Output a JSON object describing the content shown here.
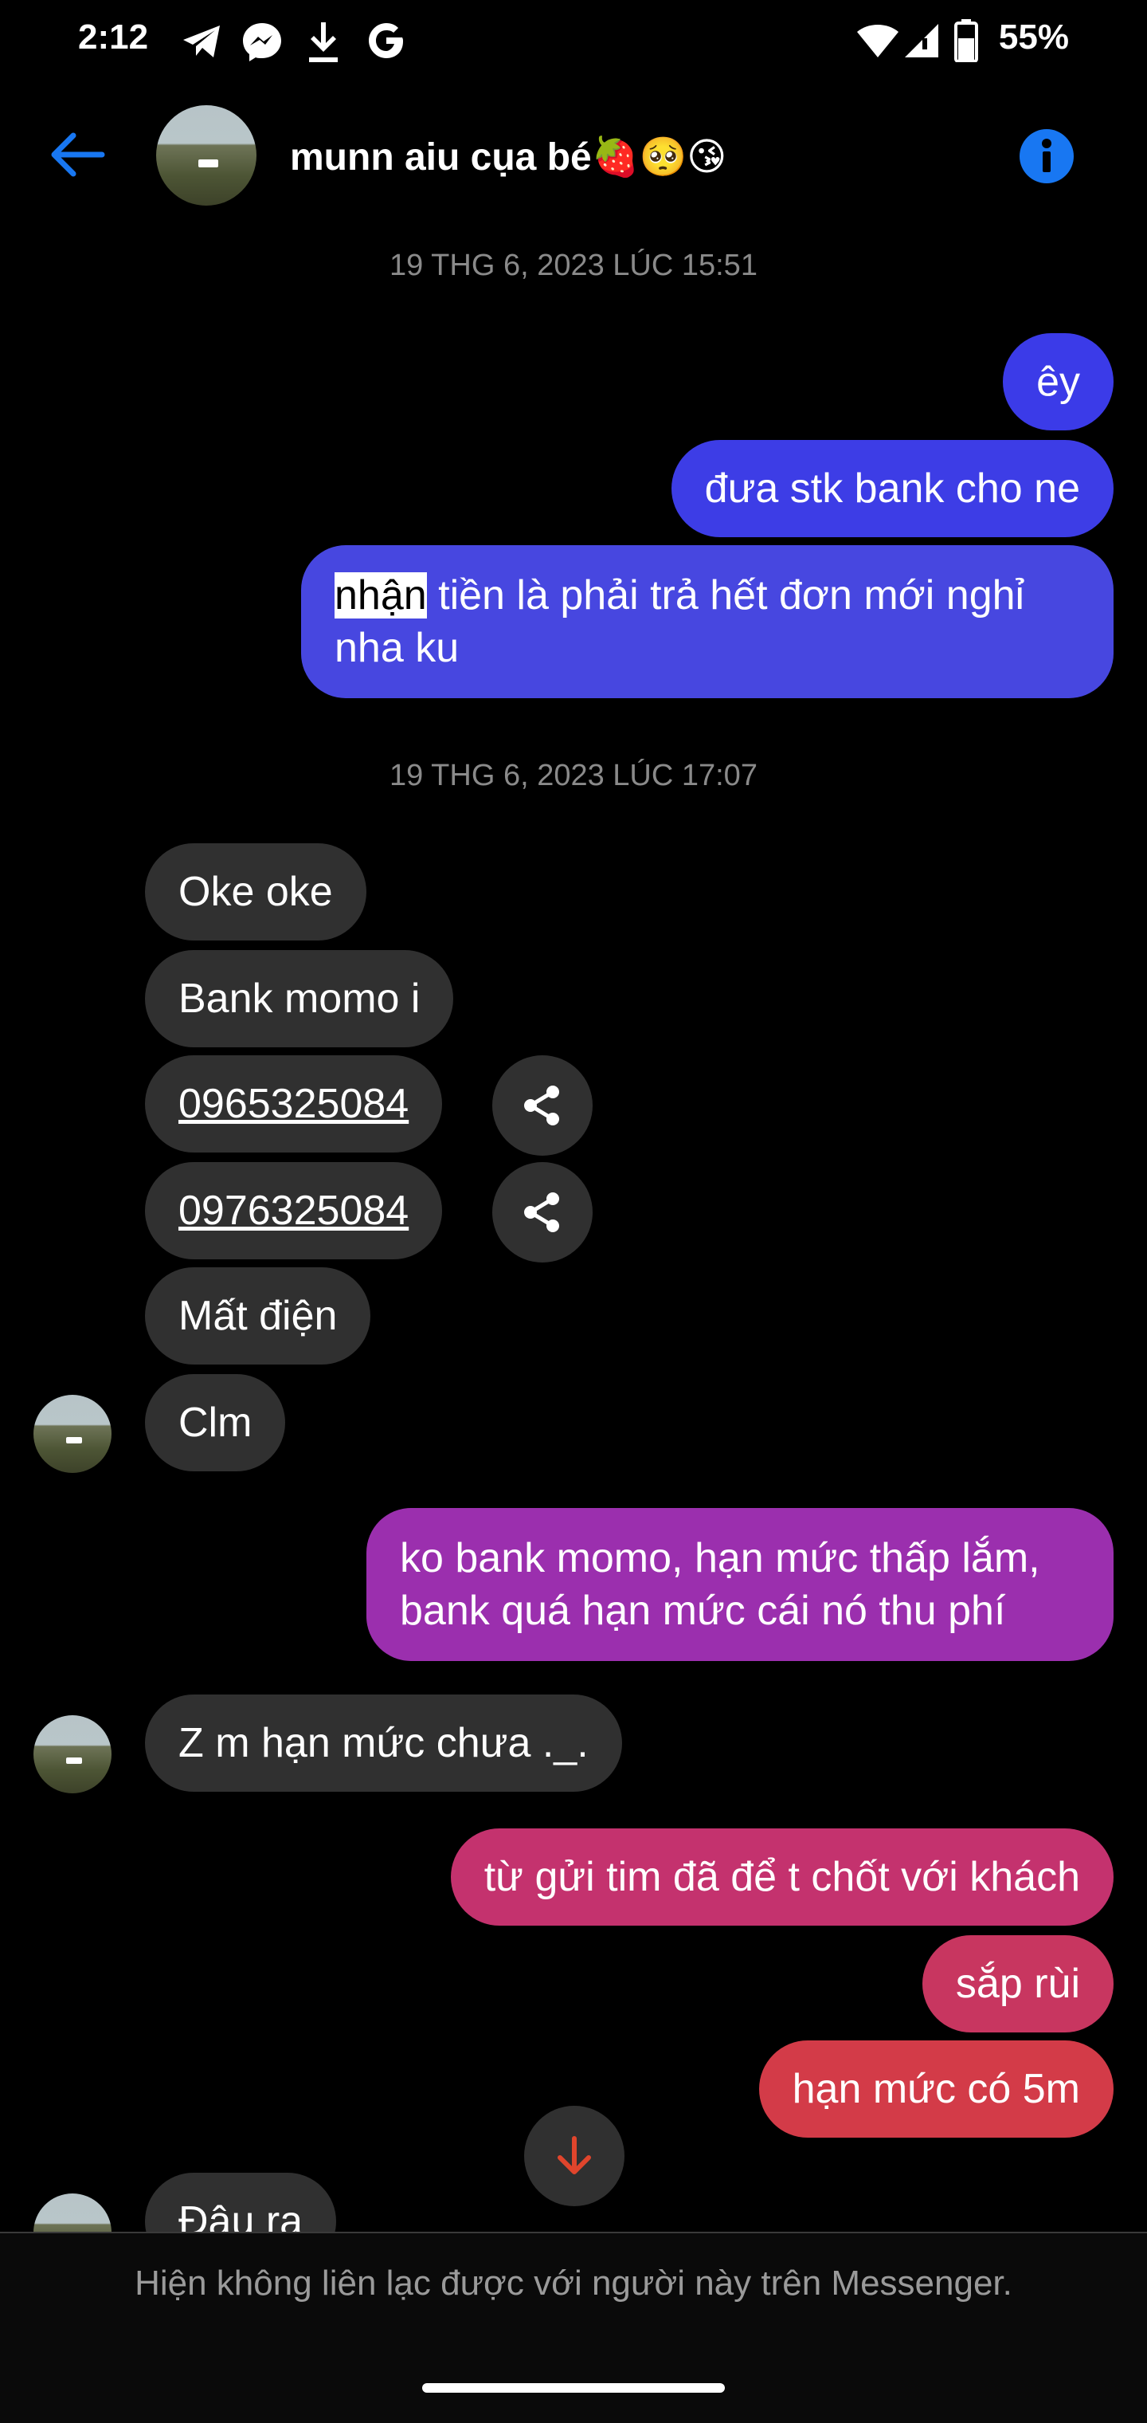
{
  "status_bar": {
    "time": "2:12",
    "battery": "55%",
    "notification_icons": [
      "telegram-icon",
      "messenger-icon",
      "download-icon",
      "google-icon"
    ],
    "system_icons": [
      "wifi-icon",
      "signal-icon",
      "battery-icon"
    ]
  },
  "header": {
    "back_icon": "arrow-left-icon",
    "contact_name": "munn aiu cụa bé🍓🥺😘",
    "info_icon": "info-icon",
    "accent": "#1877f2"
  },
  "timestamps": [
    "19 THG 6, 2023 LÚC 15:51",
    "19 THG 6, 2023 LÚC 17:07"
  ],
  "messages": {
    "out1": "êy",
    "out2": "đưa stk bank cho ne",
    "out3_hl": "nhận",
    "out3_rest": " tiền là phải trả hết đơn mới nghỉ nha ku",
    "in1": "Oke oke",
    "in2": "Bank momo i",
    "in3": "0965325084",
    "in4": "0976325084",
    "in5": "Mất điện",
    "in6": "Clm",
    "out4": "ko bank momo, hạn mức thấp lắm, bank quá hạn mức cái nó thu phí",
    "in7": "Z m hạn mức chưa ._.",
    "out5": "từ gửi tim đã để t chốt với khách",
    "out6": "sắp rùi",
    "out7": "hạn mức có 5m",
    "in8": "Đâu ra"
  },
  "colors": {
    "out_blue": "#3d3de6",
    "out_violet": "#4747e0",
    "out_purple": "#9b2fae",
    "out_magenta": "#c4326e",
    "out_red": "#d33b48",
    "incoming": "#303030",
    "scroll_arrow": "#e0452c"
  },
  "footer": {
    "notice": "Hiện không liên lạc được với người này trên Messenger."
  }
}
